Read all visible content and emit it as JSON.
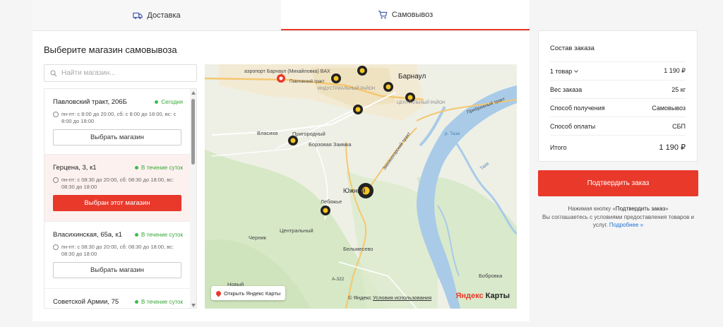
{
  "tabs": [
    {
      "label": "Доставка",
      "icon": "truck-icon"
    },
    {
      "label": "Самовывоз",
      "icon": "cart-icon"
    }
  ],
  "section_title": "Выберите магазин самовывоза",
  "search": {
    "placeholder": "Найти магазин..."
  },
  "stores": [
    {
      "name": "Павловский тракт, 206Б",
      "availability": "Сегодня",
      "hours": "пн-пт: с 8:00 до 20:00, сб: с 8:00 до 18:00, вс: с 8:00 до 18:00",
      "button": "Выбрать магазин"
    },
    {
      "name": "Герцена, 3, к1",
      "availability": "В течение суток",
      "hours": "пн-пт: с 08:30 до 20:00, сб: 08:30 до 18:00, вс: 08:30 до 18:00",
      "button": "Выбран этот магазин"
    },
    {
      "name": "Власихинская, 65а, к1",
      "availability": "В течение суток",
      "hours": "пн-пт: с 08:30 до 20:00, сб: 08:30 до 18:00, вс: 08:30 до 18:00",
      "button": "Выбрать магазин"
    },
    {
      "name": "Советской Армии, 75",
      "availability": "В течение суток"
    }
  ],
  "map": {
    "labels": {
      "airport": "аэропорт Барнаул (Михайловка) BAX",
      "barnaul": "Барнаул",
      "industrial": "ИНДУСТРИАЛЬНЫЙ РАЙОН",
      "central": "ЦЕНТРАЛЬНЫЙ РАЙОН",
      "pavlovsky": "Павловский тракт",
      "vlasikha": "Власиха",
      "prigorodny": "Пригородный",
      "borzovaya": "Борзовая Заимка",
      "yuzhny": "Южный",
      "lebyazhye": "Лебяжье",
      "tsentralny": "Центральный",
      "chernik": "Черник",
      "belmesevo": "Бельмесево",
      "novy": "Новый",
      "bobrovka": "Бобровка",
      "privolzh": "Прибрежный тракт",
      "tayozhny": "Змеиногорский тракт",
      "a322": "А-322",
      "p_taza1": "р. Таза",
      "p_taza2": "Таза"
    },
    "open_button": "Открыть Яндекс Карты",
    "copyright": "© Яндекс",
    "terms": "Условия использования",
    "logo_yandex": "Яндекс",
    "logo_maps": "Карты"
  },
  "order": {
    "title": "Состав заказа",
    "items_label": "1 товар",
    "items_value": "1 190 ₽",
    "weight_label": "Вес заказа",
    "weight_value": "25 кг",
    "method_label": "Способ получения",
    "method_value": "Самовывоз",
    "payment_label": "Способ оплаты",
    "payment_value": "СБП",
    "total_label": "Итого",
    "total_value": "1 190 ₽"
  },
  "confirm_button": "Подтвердить заказ",
  "note": {
    "line1": "Нажимая кнопку «",
    "bold": "Подтвердить заказ",
    "line2": "»",
    "line3": "Вы соглашаетесь с условиями предоставления товаров и услуг.",
    "link": "Подробнее »"
  },
  "colors": {
    "accent": "#e8392b",
    "available": "#3bbf4a",
    "link": "#1f6fd1"
  }
}
